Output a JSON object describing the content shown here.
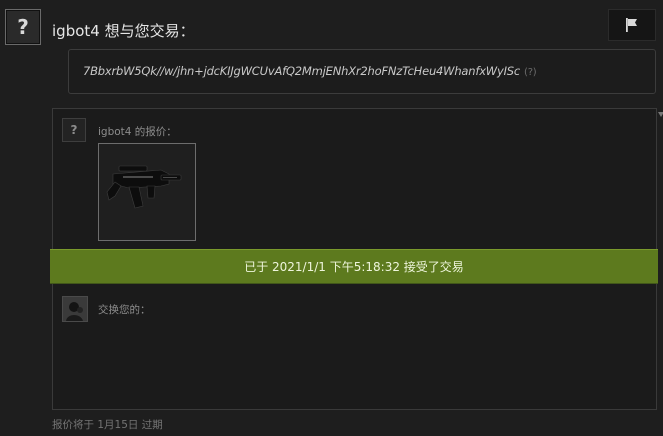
{
  "header": {
    "avatar_glyph": "?",
    "title": "igbot4 想与您交易："
  },
  "message": {
    "text": "7BbxrbW5Qk//w/jhn+jdcKIJgWCUvAfQ2MmjENhXr2hoFNzTcHeu4WhanfxWyISc",
    "help": "(?)"
  },
  "offer": {
    "avatar_glyph": "?",
    "label": "igbot4 的报价：",
    "item_icon": "gun-item-icon"
  },
  "status": {
    "accepted_text": "已于 2021/1/1 下午5:18:32 接受了交易"
  },
  "your_offer": {
    "label": "交换您的："
  },
  "footer": {
    "expiry": "报价将于 1月15日 过期"
  },
  "colors": {
    "accepted_green": "#5d7a1e",
    "background": "#1e1e1e"
  },
  "icons": [
    "flag-icon",
    "gun-item-icon",
    "user-avatar-icon",
    "dropdown-arrow-icon"
  ]
}
